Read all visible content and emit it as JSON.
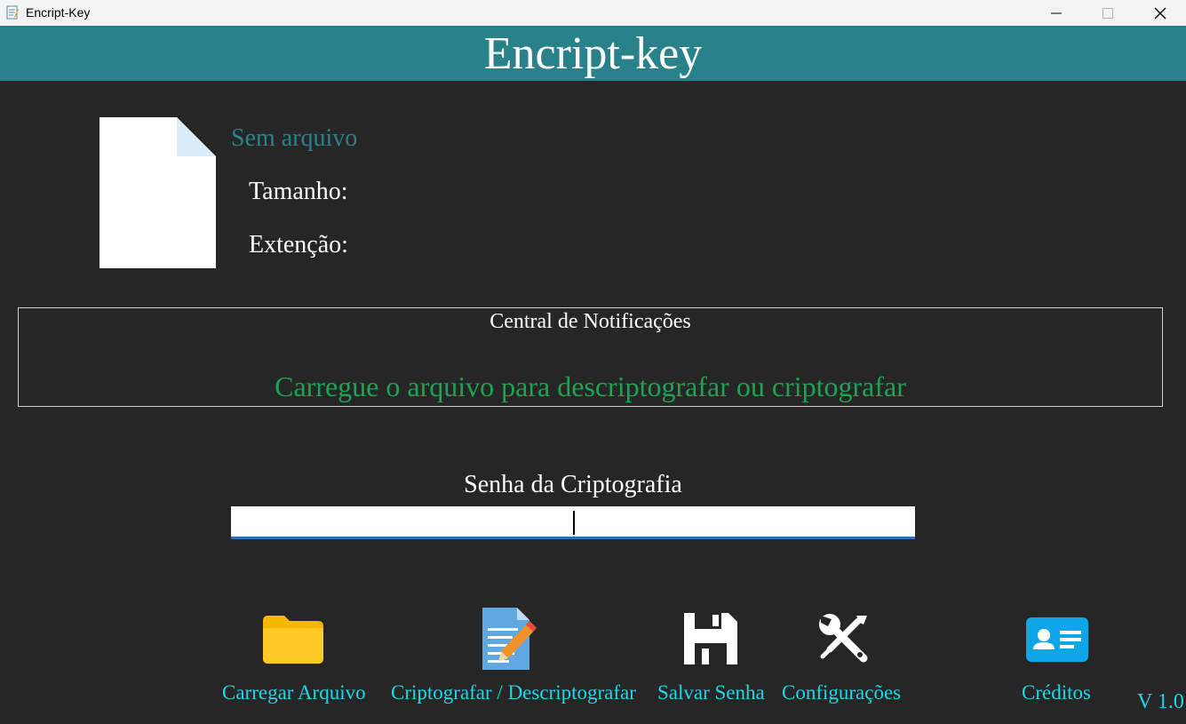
{
  "window": {
    "title": "Encript-Key"
  },
  "header": {
    "title": "Encript-key"
  },
  "file": {
    "name": "Sem arquivo",
    "size_label": "Tamanho:",
    "ext_label": "Extenção:"
  },
  "notifications": {
    "title": "Central de Notificações",
    "message": "Carregue o arquivo para descriptografar ou criptografar"
  },
  "password": {
    "label": "Senha da Criptografia",
    "value": ""
  },
  "toolbar": {
    "load": "Carregar Arquivo",
    "crypt": "Criptografar / Descriptografar",
    "save": "Salvar Senha",
    "settings": "Configurações",
    "credits": "Créditos"
  },
  "version": "V 1.0",
  "colors": {
    "header": "#29828a",
    "background": "#262626",
    "accent_text": "#22d6e8",
    "notification_text": "#1fa352"
  }
}
